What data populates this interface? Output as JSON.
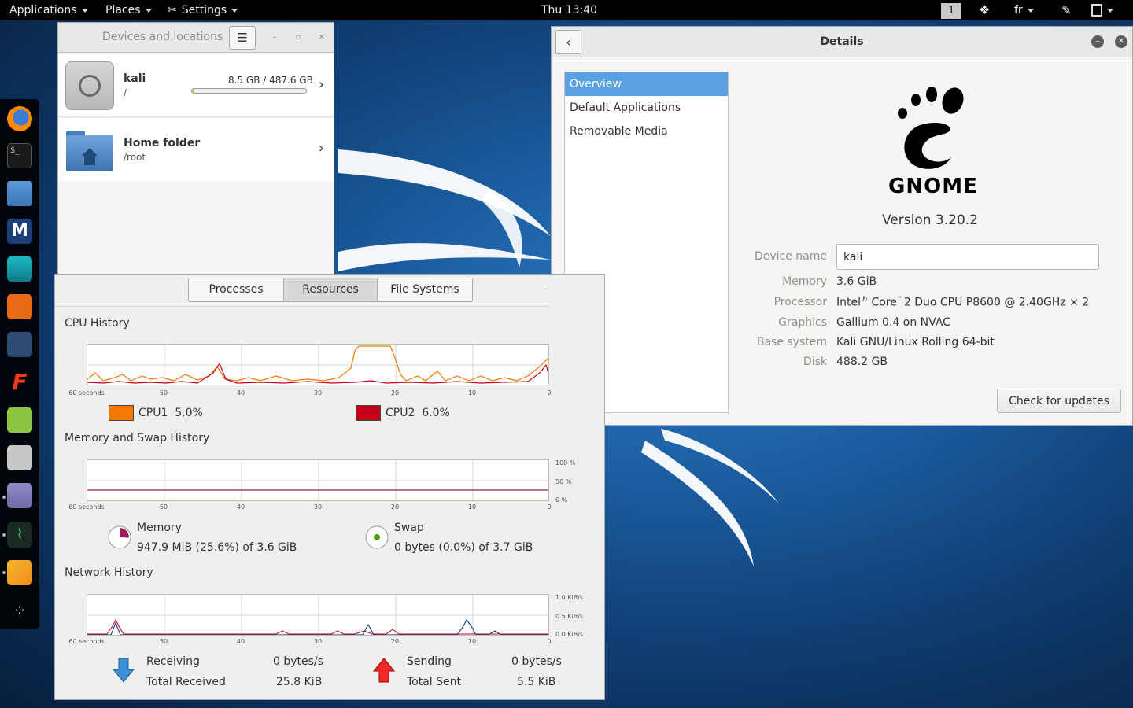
{
  "topbar": {
    "applications": "Applications",
    "places": "Places",
    "settings": "Settings",
    "clock": "Thu 13:40",
    "workspace": "1",
    "keyboard_layout": "fr"
  },
  "dock": {
    "icons": [
      "firefox-icon",
      "terminal-icon",
      "files-icon",
      "metasploit-icon",
      "armitage-icon",
      "burpsuite-icon",
      "beef-icon",
      "faraday-icon",
      "notes-icon",
      "disk-usage-icon",
      "tweaks-icon",
      "system-monitor-icon",
      "other-app-icon",
      "show-apps-icon"
    ]
  },
  "files_window": {
    "title": "Devices and locations",
    "places": [
      {
        "name": "kali",
        "path": "/",
        "usage": "8.5 GB / 487.6 GB",
        "usage_fraction": 0.017
      },
      {
        "name": "Home folder",
        "path": "/root"
      }
    ]
  },
  "details_window": {
    "title": "Details",
    "sidebar": [
      "Overview",
      "Default Applications",
      "Removable Media"
    ],
    "logo_text": "GNOME",
    "version": "Version 3.20.2",
    "labels": {
      "device_name": "Device name",
      "memory": "Memory",
      "processor": "Processor",
      "graphics": "Graphics",
      "base_system": "Base system",
      "disk": "Disk"
    },
    "values": {
      "device_name": "kali",
      "memory": "3.6 GiB",
      "processor_pre": "Intel",
      "processor_sup1": "®",
      "processor_mid": " Core",
      "processor_sup2": "™",
      "processor_post": "2 Duo CPU P8600 @ 2.40GHz × 2",
      "graphics": "Gallium 0.4 on NVAC",
      "base_system": "Kali GNU/Linux Rolling 64-bit",
      "disk": "488.2 GB"
    },
    "check_updates": "Check for updates"
  },
  "system_monitor": {
    "tabs": [
      "Processes",
      "Resources",
      "File Systems"
    ],
    "active_tab": "Resources",
    "x_ticks": [
      "60 seconds",
      "50",
      "40",
      "30",
      "20",
      "10",
      "0"
    ],
    "cpu": {
      "title": "CPU History",
      "series": [
        {
          "name": "CPU1",
          "value": "5.0%",
          "color": "#f57900"
        },
        {
          "name": "CPU2",
          "value": "6.0%",
          "color": "#c4001a"
        }
      ]
    },
    "memory": {
      "title": "Memory and Swap History",
      "y_ticks": [
        "100 %",
        "50 %",
        "0 %"
      ],
      "memory_label": "Memory",
      "memory_value": "947.9 MiB (25.6%) of 3.6 GiB",
      "memory_fraction": 0.256,
      "swap_label": "Swap",
      "swap_value": "0 bytes (0.0%) of 3.7 GiB",
      "swap_fraction": 0.0
    },
    "network": {
      "title": "Network History",
      "y_ticks": [
        "1.0 KiB/s",
        "0.5 KiB/s",
        "0.0 KiB/s"
      ],
      "receiving_label": "Receiving",
      "receiving_value": "0 bytes/s",
      "total_received_label": "Total Received",
      "total_received_value": "25.8 KiB",
      "sending_label": "Sending",
      "sending_value": "0 bytes/s",
      "total_sent_label": "Total Sent",
      "total_sent_value": "5.5 KiB"
    }
  }
}
